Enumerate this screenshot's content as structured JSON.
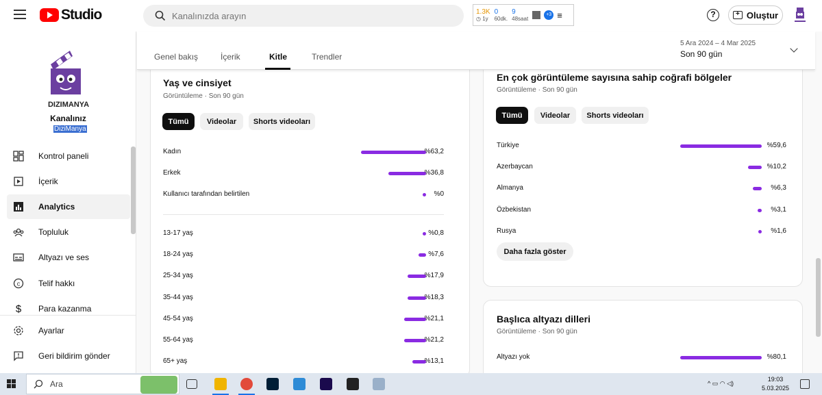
{
  "header": {
    "logo_text": "Studio",
    "search_placeholder": "Kanalınızda arayın",
    "create_label": "Oluştur",
    "extension": {
      "stat1_big": "1.3K",
      "stat1_small": "◷ 1y",
      "stat2_big": "0",
      "stat2_small": "60dk.",
      "stat3_big": "9",
      "stat3_small": "48saat",
      "badge": "+3"
    },
    "help_symbol": "?"
  },
  "channel": {
    "logo_text": "DIZIMANYA",
    "label": "Kanalınız",
    "name": "DiziManya"
  },
  "sidebar": {
    "items": [
      {
        "label": "Kontrol paneli",
        "icon": "dashboard-icon"
      },
      {
        "label": "İçerik",
        "icon": "content-icon"
      },
      {
        "label": "Analytics",
        "icon": "analytics-icon",
        "active": true
      },
      {
        "label": "Topluluk",
        "icon": "community-icon"
      },
      {
        "label": "Altyazı ve ses",
        "icon": "subtitles-icon"
      },
      {
        "label": "Telif hakkı",
        "icon": "copyright-icon"
      },
      {
        "label": "Para kazanma",
        "icon": "monetization-icon"
      }
    ],
    "bottom": [
      {
        "label": "Ayarlar",
        "icon": "gear-icon"
      },
      {
        "label": "Geri bildirim gönder",
        "icon": "feedback-icon"
      }
    ]
  },
  "tabs": {
    "items": [
      "Genel bakış",
      "İçerik",
      "Kitle",
      "Trendler"
    ],
    "active": "Kitle"
  },
  "date_range": {
    "range": "5 Ara 2024 – 4 Mar 2025",
    "label": "Son 90 gün"
  },
  "age_gender_card": {
    "title": "Yaş ve cinsiyet",
    "subtitle": "Görüntüleme · Son 90 gün",
    "chips": [
      "Tümü",
      "Videolar",
      "Shorts videoları"
    ],
    "gender_rows": [
      {
        "label": "Kadın",
        "value": "%63,2",
        "fraction": 0.632
      },
      {
        "label": "Erkek",
        "value": "%36,8",
        "fraction": 0.368
      },
      {
        "label": "Kullanıcı tarafından belirtilen",
        "value": "%0",
        "fraction": 0
      }
    ],
    "age_rows": [
      {
        "label": "13-17 yaş",
        "value": "%0,8",
        "fraction": 0.008
      },
      {
        "label": "18-24 yaş",
        "value": "%7,6",
        "fraction": 0.076
      },
      {
        "label": "25-34 yaş",
        "value": "%17,9",
        "fraction": 0.179
      },
      {
        "label": "35-44 yaş",
        "value": "%18,3",
        "fraction": 0.183
      },
      {
        "label": "45-54 yaş",
        "value": "%21,1",
        "fraction": 0.211
      },
      {
        "label": "55-64 yaş",
        "value": "%21,2",
        "fraction": 0.212
      },
      {
        "label": "65+ yaş",
        "value": "%13,1",
        "fraction": 0.131
      }
    ]
  },
  "geo_card": {
    "title": "En çok görüntüleme sayısına sahip coğrafi bölgeler",
    "subtitle": "Görüntüleme · Son 90 gün",
    "chips": [
      "Tümü",
      "Videolar",
      "Shorts videoları"
    ],
    "rows": [
      {
        "label": "Türkiye",
        "value": "%59,6",
        "fraction": 0.596
      },
      {
        "label": "Azerbaycan",
        "value": "%10,2",
        "fraction": 0.102
      },
      {
        "label": "Almanya",
        "value": "%6,3",
        "fraction": 0.063
      },
      {
        "label": "Özbekistan",
        "value": "%3,1",
        "fraction": 0.031
      },
      {
        "label": "Rusya",
        "value": "%1,6",
        "fraction": 0.016
      }
    ],
    "more_label": "Daha fazla göster"
  },
  "subtitle_card": {
    "title": "Başlıca altyazı dilleri",
    "subtitle": "Görüntüleme · Son 90 gün",
    "rows": [
      {
        "label": "Altyazı yok",
        "value": "%80,1",
        "fraction": 0.801
      }
    ]
  },
  "taskbar": {
    "search_placeholder": "Ara",
    "time": "19:03",
    "date": "5.03.2025"
  },
  "colors": {
    "bar": "#8a2be2",
    "accent": "#ff0000"
  }
}
